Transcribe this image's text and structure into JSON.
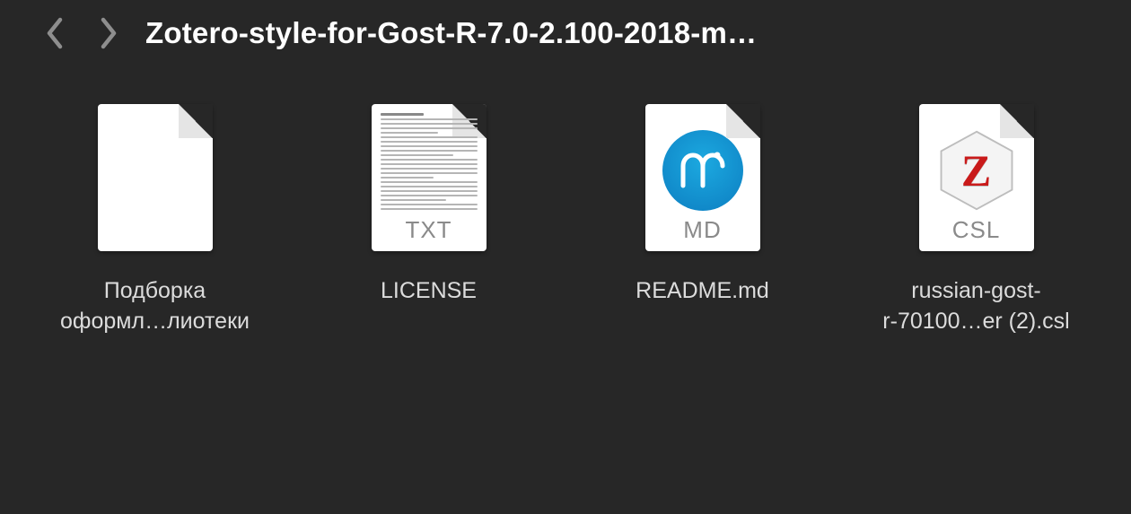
{
  "header": {
    "title": "Zotero-style-for-Gost-R-7.0-2.100-2018-m…"
  },
  "files": [
    {
      "type": "blank",
      "label_line1": "Подборка",
      "label_line2": "оформл…лиотеки",
      "badge": ""
    },
    {
      "type": "txt",
      "label_line1": "LICENSE",
      "label_line2": "",
      "badge": "TXT"
    },
    {
      "type": "md",
      "label_line1": "README.md",
      "label_line2": "",
      "badge": "MD"
    },
    {
      "type": "csl",
      "label_line1": "russian-gost-",
      "label_line2": "r-70100…er (2).csl",
      "badge": "CSL"
    }
  ]
}
